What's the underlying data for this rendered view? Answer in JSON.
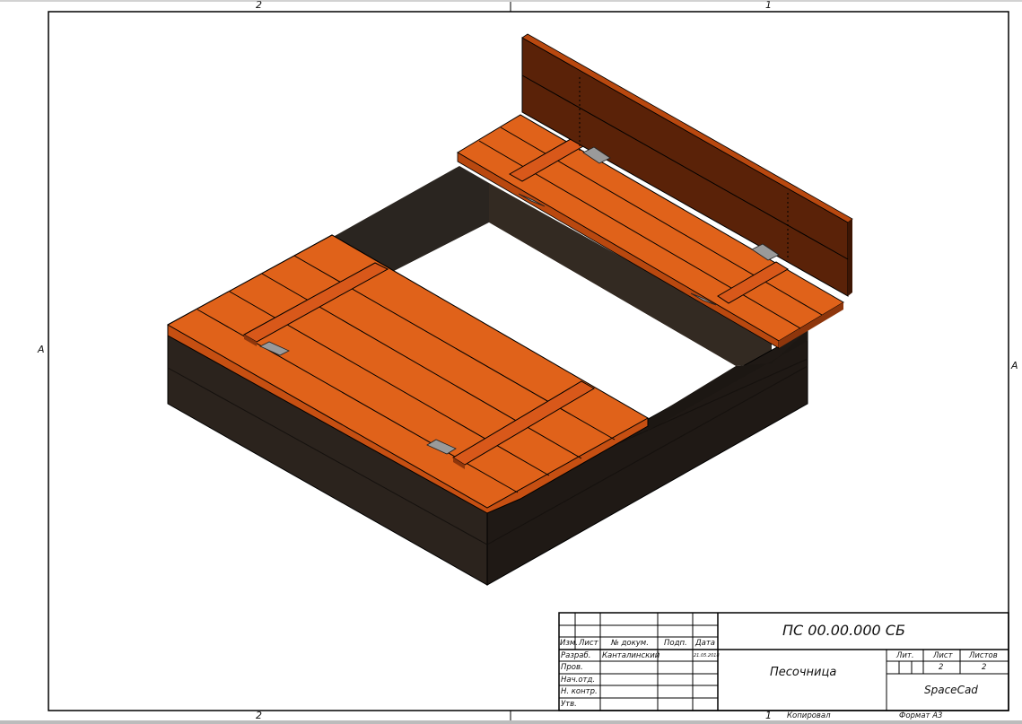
{
  "zones": {
    "top_left": "2",
    "top_right": "1",
    "left": "A",
    "right": "A",
    "bottom_left": "2",
    "bottom_right": "1"
  },
  "title_block": {
    "designation": "ПС 00.00.000 СБ",
    "name": "Песочница",
    "company": "SpaceCad",
    "headers": {
      "izm": "Изм.",
      "list": "Лист",
      "doc_no": "№ докум.",
      "sign": "Подп.",
      "date": "Дата"
    },
    "roles": {
      "developer": "Разраб.",
      "checked": "Пров.",
      "head": "Нач.отд.",
      "norm_control": "Н. контр.",
      "approved": "Утв."
    },
    "developer_name": "Канталинский",
    "developer_date": "21.05.2018",
    "lit_label": "Лит.",
    "sheet_label": "Лист",
    "sheets_label": "Листов",
    "sheet_value": "2",
    "sheets_value": "2",
    "copied": "Копировал",
    "format": "Формат А3"
  },
  "colors": {
    "board": "#e0621a",
    "board_dark": "#9c3c0c",
    "frame": "#2b231d",
    "frame_shadow": "#1f1915",
    "lid_back": "#5a2208",
    "hinge": "#9a9a9a"
  }
}
